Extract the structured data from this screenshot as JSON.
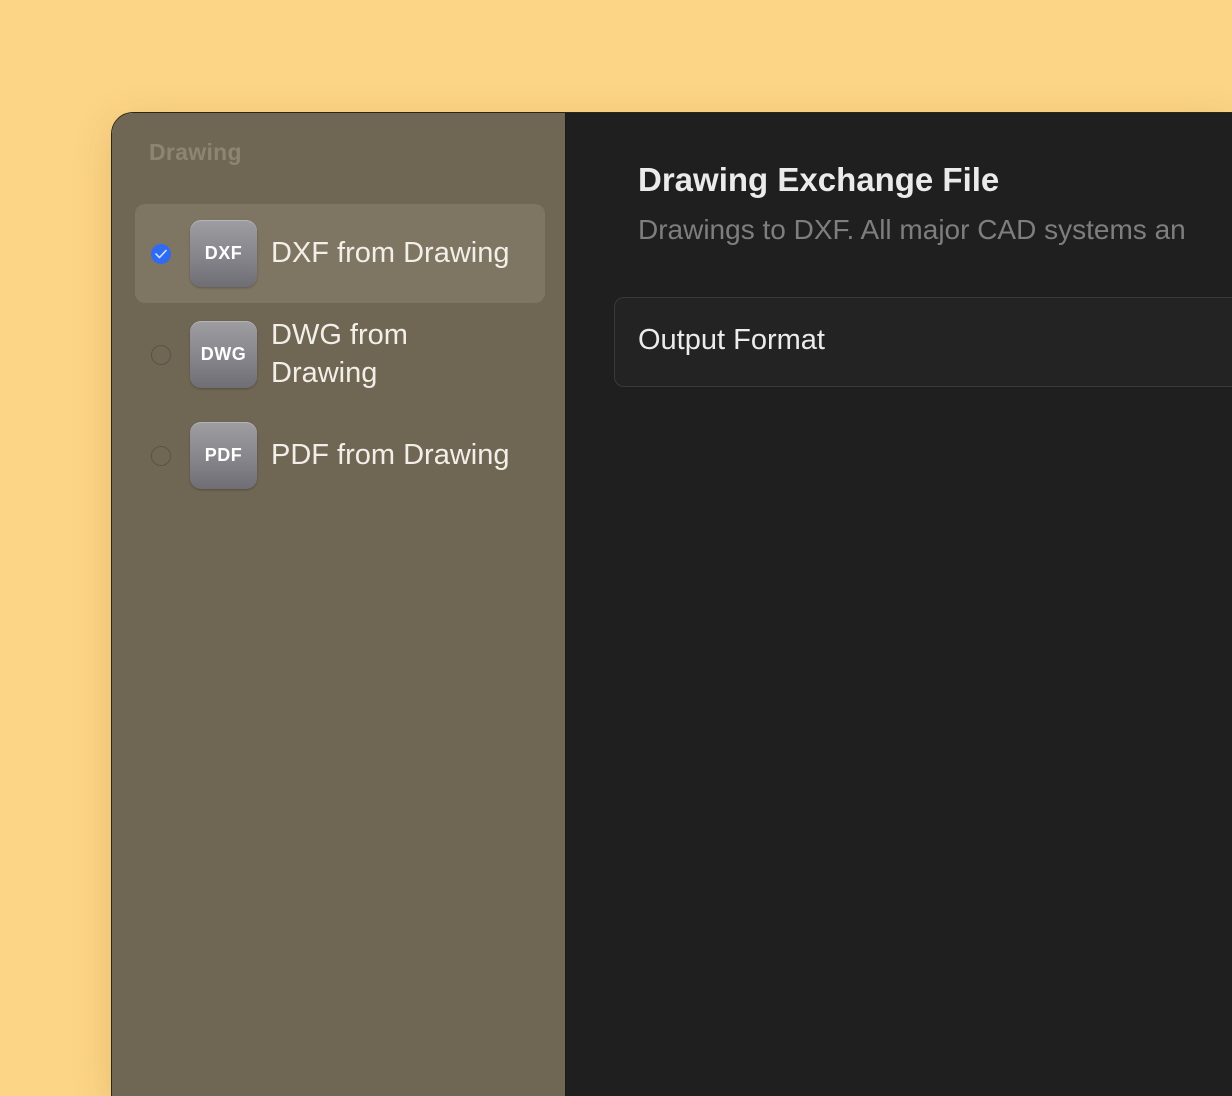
{
  "sidebar": {
    "heading": "Drawing",
    "items": [
      {
        "icon_text": "DXF",
        "label": "DXF from Drawing",
        "selected": true
      },
      {
        "icon_text": "DWG",
        "label": "DWG from Drawing",
        "selected": false
      },
      {
        "icon_text": "PDF",
        "label": "PDF from Drawing",
        "selected": false
      }
    ]
  },
  "main": {
    "title": "Drawing Exchange File",
    "subtitle": "Drawings to DXF. All major CAD systems an",
    "panel": {
      "label": "Output Format"
    }
  },
  "colors": {
    "background": "#fdd587",
    "sidebar": "#706654",
    "sidebar_selected": "#7f7563",
    "main": "#1f1f1f",
    "accent": "#2f6bf2"
  },
  "icons": {
    "radio_checked": "checkmark-icon"
  }
}
